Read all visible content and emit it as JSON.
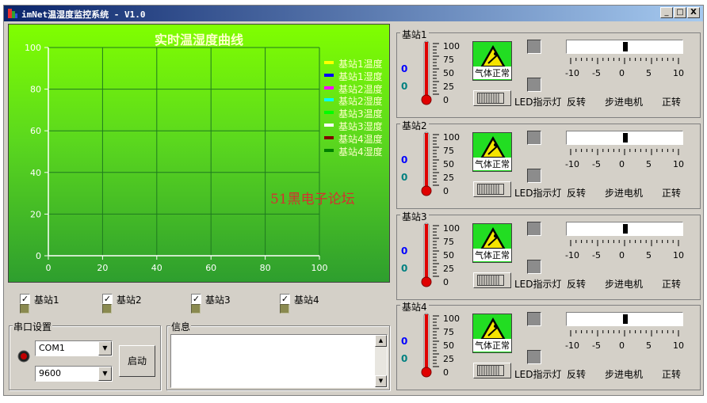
{
  "window": {
    "title": "imNet温湿度监控系统 - V1.0",
    "controls": [
      "_",
      "□",
      "X"
    ]
  },
  "chart_data": {
    "type": "line",
    "title": "实时温湿度曲线",
    "xlabel": "",
    "ylabel": "",
    "xlim": [
      0,
      100
    ],
    "ylim": [
      0,
      100
    ],
    "x_ticks": [
      0,
      20,
      40,
      60,
      80,
      100
    ],
    "y_ticks": [
      0,
      20,
      40,
      60,
      80,
      100
    ],
    "grid": true,
    "legend_position": "right",
    "series": [
      {
        "name": "基站1温度",
        "color": "#ffff00",
        "values": []
      },
      {
        "name": "基站1湿度",
        "color": "#0000ff",
        "values": []
      },
      {
        "name": "基站2温度",
        "color": "#ff00ff",
        "values": []
      },
      {
        "name": "基站2湿度",
        "color": "#00ffff",
        "values": []
      },
      {
        "name": "基站3温度",
        "color": "#00ff00",
        "values": []
      },
      {
        "name": "基站3湿度",
        "color": "#ffffff",
        "values": []
      },
      {
        "name": "基站4温度",
        "color": "#800000",
        "values": []
      },
      {
        "name": "基站4湿度",
        "color": "#008000",
        "values": []
      }
    ],
    "watermark": "51黑电子论坛"
  },
  "station_checks": [
    {
      "label": "基站1",
      "checked": true
    },
    {
      "label": "基站2",
      "checked": true
    },
    {
      "label": "基站3",
      "checked": true
    },
    {
      "label": "基站4",
      "checked": true
    }
  ],
  "serial": {
    "group_label": "串口设置",
    "port": "COM1",
    "baud": "9600",
    "start_label": "启动"
  },
  "info": {
    "group_label": "信息",
    "text": ""
  },
  "stations": [
    {
      "title": "基站1",
      "temp": "0",
      "humidity": "0",
      "gauge_percent": 0,
      "warn_text": "气体正常",
      "led_label": "LED指示灯",
      "reverse_label": "反转",
      "motor_label": "步进电机",
      "forward_label": "正转",
      "slider_value": 0
    },
    {
      "title": "基站2",
      "temp": "0",
      "humidity": "0",
      "gauge_percent": 0,
      "warn_text": "气体正常",
      "led_label": "LED指示灯",
      "reverse_label": "反转",
      "motor_label": "步进电机",
      "forward_label": "正转",
      "slider_value": 0
    },
    {
      "title": "基站3",
      "temp": "0",
      "humidity": "0",
      "gauge_percent": 0,
      "warn_text": "气体正常",
      "led_label": "LED指示灯",
      "reverse_label": "反转",
      "motor_label": "步进电机",
      "forward_label": "正转",
      "slider_value": 0
    },
    {
      "title": "基站4",
      "temp": "0",
      "humidity": "0",
      "gauge_percent": 0,
      "warn_text": "气体正常",
      "led_label": "LED指示灯",
      "reverse_label": "反转",
      "motor_label": "步进电机",
      "forward_label": "正转",
      "slider_value": 0
    }
  ],
  "gauge_scale": [
    "100",
    "75",
    "50",
    "25",
    "0"
  ],
  "slider_ticks": [
    "-10",
    "-5",
    "0",
    "5",
    "10"
  ],
  "colors": {
    "titlebar": "#0a246a",
    "face": "#d4d0c8",
    "temp_value": "#0000ff",
    "humidity_value": "#008080",
    "thermo_red": "#e00000",
    "warn_green": "#22dd22"
  }
}
